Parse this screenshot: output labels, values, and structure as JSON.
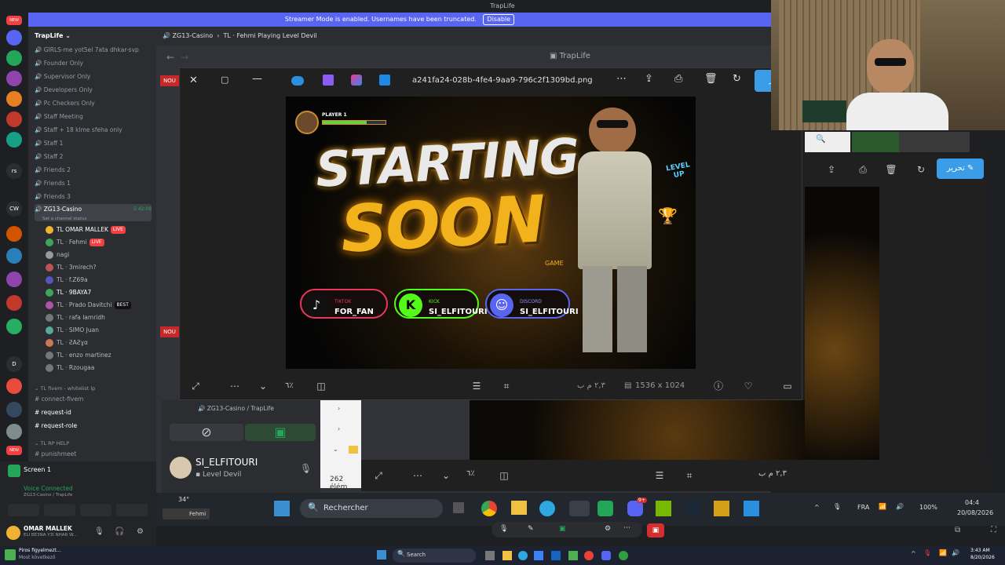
{
  "window": {
    "title": "TrapLife"
  },
  "banner": {
    "text": "Streamer Mode is enabled. Usernames have been truncated.",
    "disable_label": "Disable"
  },
  "servers": [
    {
      "label": "NEW",
      "color": "#f23f42"
    },
    {
      "label": "",
      "color": "#5865f2"
    },
    {
      "label": "",
      "color": "#23a55a"
    },
    {
      "label": "",
      "color": "#8e44ad"
    },
    {
      "label": "",
      "color": "#e67e22"
    },
    {
      "label": "rs",
      "color": "#2b2d31"
    },
    {
      "label": "CW",
      "color": "#2b2d31"
    },
    {
      "label": "D",
      "color": "#2b2d31"
    },
    {
      "label": "NEW",
      "color": "#f23f42"
    }
  ],
  "server_name": "TrapLife",
  "channels": [
    "GIRLS-me yot5el 7ata dhkar-svp",
    "Founder Only",
    "Supervisor Only",
    "Developers Only",
    "Pc Checkers Only",
    "Staff Meeting",
    "Staff + 18 klme sfeha only",
    "Staff 1",
    "Staff 2",
    "Friends 2",
    "Friends 1",
    "Friends 3"
  ],
  "voice_channel": {
    "name": "ZG13-Casino",
    "timer": "5:42:09",
    "status": "Set a channel status"
  },
  "voice_users": [
    {
      "name": "TL OMAR MALLEK",
      "badge": "LIVE",
      "color": "#f0b232"
    },
    {
      "name": "TL · Fehmi",
      "badge": "LIVE",
      "color": "#3ba55d"
    },
    {
      "name": "nagi",
      "badge": "",
      "color": "#999999"
    },
    {
      "name": "TL · 3mirech?",
      "badge": "",
      "color": "#b55"
    },
    {
      "name": "TL · f.Z69a",
      "badge": "",
      "color": "#55b"
    },
    {
      "name": "TL · 9BAYA7",
      "badge": "",
      "color": "#3ba55d"
    },
    {
      "name": "TL · Prado Davitchi",
      "badge": "BEST",
      "color": "#a5a"
    },
    {
      "name": "TL · rafa lamridh",
      "badge": "",
      "color": "#777"
    },
    {
      "name": "TL · SIMO Juan",
      "badge": "",
      "color": "#5a9"
    },
    {
      "name": "TL · ƧAƧɣα",
      "badge": "",
      "color": "#c75"
    },
    {
      "name": "TL · enzo martinez",
      "badge": "",
      "color": "#777"
    },
    {
      "name": "TL · Rzougaa",
      "badge": "",
      "color": "#777"
    }
  ],
  "categories": [
    {
      "name": "TL fivem - whitelist lp"
    },
    {
      "name": "TL RP HELP"
    }
  ],
  "text_channels": [
    "connect-fivem",
    "request-id",
    "request-role",
    "punishmeet"
  ],
  "channel_header": {
    "breadcrumb": "ZG13-Casino",
    "title": "TL  ·  Fehmi Playing Level Devil"
  },
  "viewer": {
    "filename": "a241fa24-028b-4fe4-9aa9-796c2f1309bd.png",
    "dimensions": "1536 x 1024",
    "zoom": "٦٪",
    "time": "٢,٣ م ب",
    "edit_label": "تحرير"
  },
  "poster": {
    "player_label": "PLAYER 1",
    "line1": "STARTING",
    "line2": "SOON",
    "level_up": "LEVEL UP",
    "game_label": "GAME",
    "socials": [
      {
        "platform": "TIKTOK",
        "handle": "FOR_FAN",
        "color": "#e8365d",
        "icon": "♪"
      },
      {
        "platform": "KICK",
        "handle": "SI_ELFITOURI",
        "color": "#53fc18",
        "icon": "K"
      },
      {
        "platform": "DISCORD",
        "handle": "SI_ELFITOURI",
        "color": "#5865f2",
        "icon": "☺"
      }
    ]
  },
  "call": {
    "path": "ZG13-Casino / TrapLife",
    "user": "SI_ELFITOURI",
    "activity": "Level Devil"
  },
  "voice_status": {
    "screen": "Screen 1",
    "connected": "Voice Connected",
    "path": "ZG13-Casino / TrapLife"
  },
  "user_panel": {
    "name": "OMAR MALLEK",
    "status": "ELI BE3NA Y3I NHAR W..."
  },
  "file_explorer": {
    "count": "262 élém"
  },
  "taskbar": {
    "search": "Rechercher",
    "temp": "34°",
    "lang": "FRA",
    "volume": "100%",
    "time": "04:4",
    "date": "20/08/2026",
    "notif_badge": "9+",
    "fehmi_label": "Fehmi"
  },
  "taskbar_bottom": {
    "search": "Search",
    "toast_title": "Piros figyelmezt...",
    "toast_sub": "Most következő",
    "time": "3:43 AM",
    "date": "8/20/2026"
  }
}
